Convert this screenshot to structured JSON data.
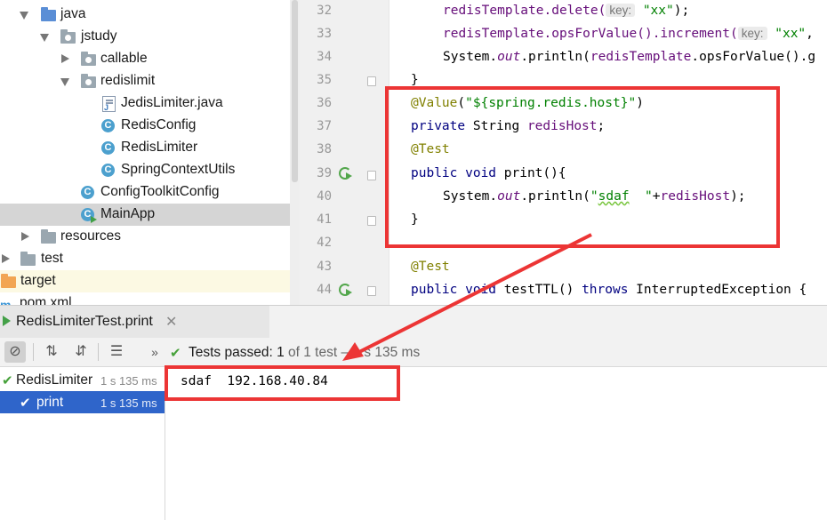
{
  "tree": {
    "items": [
      {
        "label": "java",
        "icon": "folder-blue-icon"
      },
      {
        "label": "jstudy",
        "icon": "package-icon"
      },
      {
        "label": "callable",
        "icon": "package-icon"
      },
      {
        "label": "redislimit",
        "icon": "package-icon"
      },
      {
        "label": "JedisLimiter.java",
        "icon": "java-file-icon"
      },
      {
        "label": "RedisConfig",
        "icon": "class-icon"
      },
      {
        "label": "RedisLimiter",
        "icon": "class-icon"
      },
      {
        "label": "SpringContextUtils",
        "icon": "class-icon"
      },
      {
        "label": "ConfigToolkitConfig",
        "icon": "class-icon"
      },
      {
        "label": "MainApp",
        "icon": "main-class-icon"
      },
      {
        "label": "resources",
        "icon": "folder-icon"
      },
      {
        "label": "test",
        "icon": "folder-icon"
      },
      {
        "label": "target",
        "icon": "folder-orange-icon"
      },
      {
        "label": "pom.xml",
        "icon": "maven-icon"
      }
    ]
  },
  "editor": {
    "line_numbers": [
      "32",
      "33",
      "34",
      "35",
      "36",
      "37",
      "38",
      "39",
      "40",
      "41",
      "42",
      "43",
      "44"
    ],
    "hint_key": "key:",
    "tokens": {
      "l32_a": "redisTemplate.delete(",
      "l32_b": "\"xx\"",
      "l32_c": ");",
      "l33_a": "redisTemplate.opsForValue().increment(",
      "l33_b": "\"xx\"",
      "l33_c": ",",
      "l34_a": "System.",
      "l34_b": "out",
      "l34_c": ".println(",
      "l34_d": "redisTemplate",
      "l34_e": ".opsForValue().g",
      "l35": "}",
      "l36_a": "@Value",
      "l36_b": "(",
      "l36_c": "\"${spring.redis.host}\"",
      "l36_d": ")",
      "l37_a": "private",
      "l37_b": " String ",
      "l37_c": "redisHost",
      "l37_d": ";",
      "l38": "@Test",
      "l39_a": "public void",
      "l39_b": " print(){",
      "l40_a": "System.",
      "l40_b": "out",
      "l40_c": ".println(",
      "l40_d": "\"",
      "l40_e": "sdaf",
      "l40_f": "  \"",
      "l40_g": "+",
      "l40_h": "redisHost",
      "l40_i": ");",
      "l41": "}",
      "l43": "@Test",
      "l44_a": "public void",
      "l44_b": " testTTL() ",
      "l44_c": "throws",
      "l44_d": " InterruptedException {"
    }
  },
  "run": {
    "tab_label": "RedisLimiterTest.print",
    "tab_close": "✕",
    "status": {
      "prefix": "Tests passed: ",
      "count": "1",
      "mid": " of 1 test",
      "time": " – 1 s 135 ms"
    },
    "tests": [
      {
        "name": "RedisLimiter",
        "time": "1 s 135 ms"
      },
      {
        "name": "print",
        "time": "1 s 135 ms"
      }
    ],
    "console_output": "sdaf  192.168.40.84"
  },
  "colors": {
    "annotation_red": "#ec3535",
    "selection_blue": "#2f65ca",
    "pass_green": "#46a13a"
  }
}
